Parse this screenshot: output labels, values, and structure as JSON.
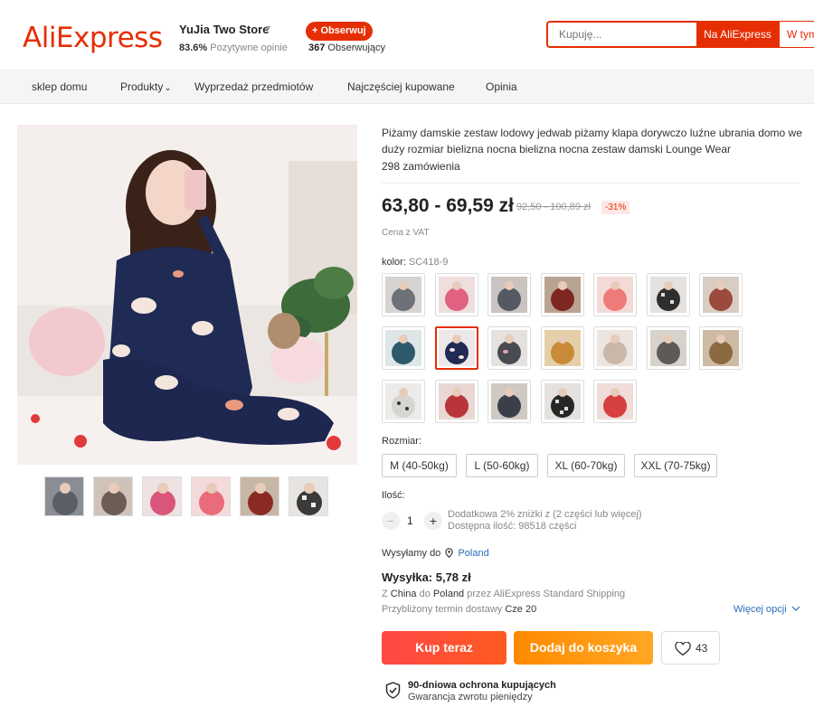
{
  "header": {
    "logo_text": "AliExpress",
    "store_name": "YuJia Two Store",
    "positive_rate": "83.6%",
    "positive_label": "Pozytywne opinie",
    "follow_label": "+ Obserwuj",
    "followers_count": "367",
    "followers_label": "Obserwujący",
    "search_placeholder": "Kupuję...",
    "search_aliexpress_label": "Na AliExpress",
    "search_store_label": "W tym sklepie"
  },
  "nav": {
    "items": [
      {
        "label": "sklep domu"
      },
      {
        "label": "Produkty"
      },
      {
        "label": "Wyprzedaż przedmiotów"
      },
      {
        "label": "Najczęściej kupowane"
      },
      {
        "label": "Opinia"
      }
    ]
  },
  "product": {
    "title": "Piżamy damskie zestaw lodowy jedwab piżamy klapa dorywczo luźne ubrania domo we duży rozmiar bielizna nocna bielizna nocna zestaw damski Lounge Wear",
    "orders": "298 zamówienia",
    "price": "63,80 - 69,59 zł",
    "old_price": "92,50 - 100,89 zł",
    "discount": "-31%",
    "vat_note": "Cena z VAT",
    "color_label": "kolor:",
    "color_value": "SC418-9",
    "selected_color_index": 8,
    "size_label": "Rozmiar:",
    "sizes": [
      "M (40-50kg)",
      "L (50-60kg)",
      "XL (60-70kg)",
      "XXL (70-75kg)"
    ],
    "quantity_label": "Ilość:",
    "quantity": "1",
    "quantity_note_1": "Dodatkowa 2% zniżki z (2 części lub więcej)",
    "quantity_note_2": "Dostępna ilość: 98518 części"
  },
  "shipping": {
    "ship_to_label": "Wysyłamy do",
    "country": "Poland",
    "price_line": "Wysyłka: 5,78 zł",
    "route_from_word": "Z",
    "route_from": "China",
    "route_to_word": "do",
    "route_to": "Poland",
    "route_via": "przez AliExpress Standard Shipping",
    "eta_label": "Przybliżony termin dostawy",
    "eta_value": "Cze 20",
    "more_options": "Więcej opcji"
  },
  "actions": {
    "buy_now": "Kup teraz",
    "add_to_cart": "Dodaj do koszyka",
    "wishlist_count": "43"
  },
  "protection": {
    "title": "90-dniowa ochrona kupujących",
    "subtitle": "Gwarancja zwrotu pieniędzy"
  },
  "icons": {
    "search_caret": "caret-down-icon",
    "location": "location-pin-icon",
    "wishlist": "heart-icon",
    "protection": "shield-check-icon",
    "more_options": "chevron-down-icon"
  },
  "colors": {
    "brand": "#e62e04",
    "buy_now": "#ff4747",
    "add_to_cart": "#ff9a1f",
    "link": "#2a6ebb"
  }
}
